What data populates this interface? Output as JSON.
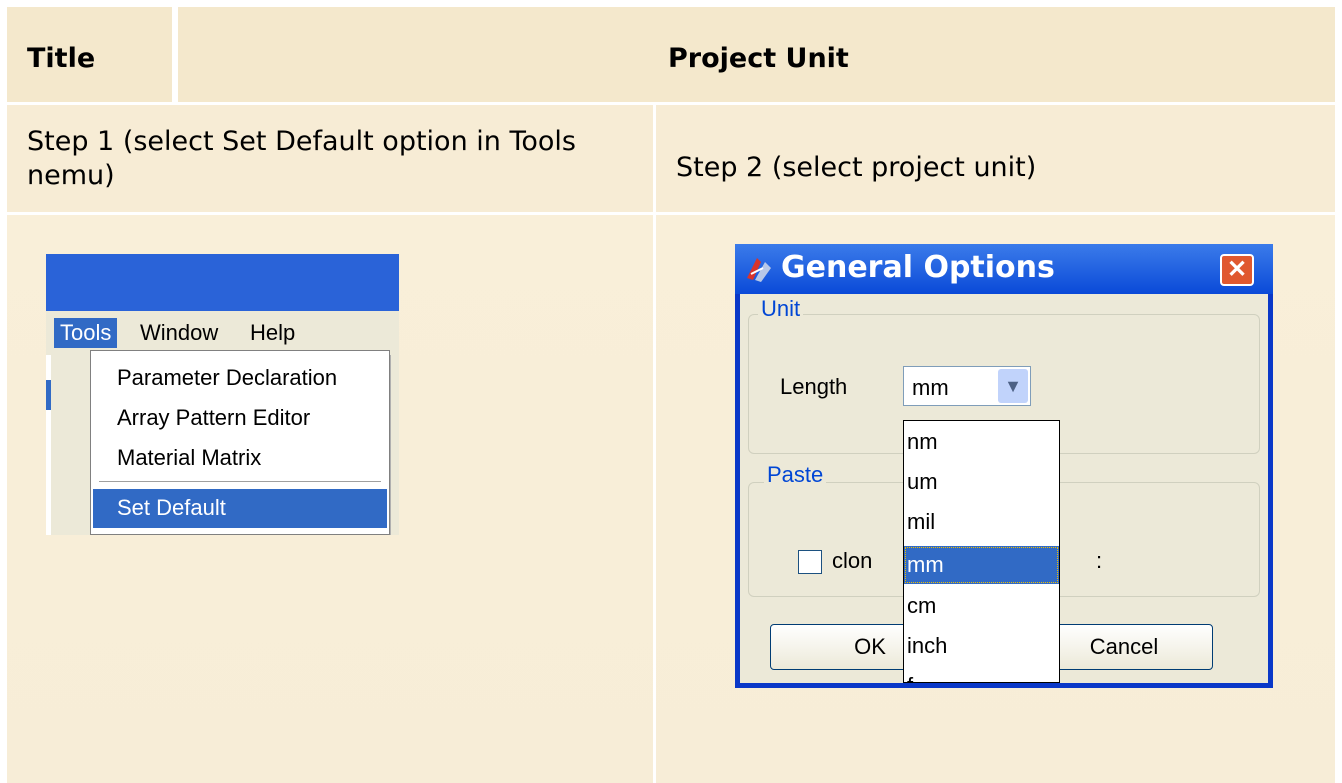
{
  "header": {
    "col1": "Title",
    "col2": "Project Unit"
  },
  "steps": {
    "step1": "Step 1 (select Set Default option in Tools nemu)",
    "step2": "Step 2 (select project unit)"
  },
  "tools_menu": {
    "menubar": [
      "Tools",
      "Window",
      "Help"
    ],
    "items": [
      "Parameter Declaration",
      "Array Pattern Editor",
      "Material Matrix",
      "Set Default"
    ],
    "selected": "Set Default"
  },
  "dialog": {
    "title": "General Options",
    "close_icon": "x-close-icon",
    "unit_group": "Unit",
    "length_label": "Length",
    "length_value": "mm",
    "paste_group": "Paste",
    "clone_label_visible": "clon",
    "ok_label_visible": "OK",
    "cancel_label": "Cancel",
    "unit_options": [
      "nm",
      "um",
      "mil",
      "mm",
      "cm",
      "inch",
      "f..."
    ],
    "selected_option": "mm"
  },
  "colors": {
    "header_bg": "#f4e8cc",
    "row_bg": "#f7ecd5",
    "xp_blue": "#0a4ad8",
    "selection": "#316ac5"
  }
}
